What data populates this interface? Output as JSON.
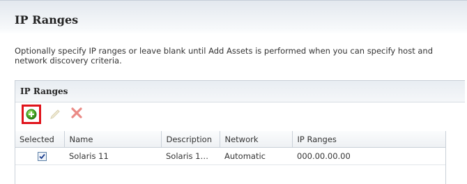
{
  "page": {
    "title": "IP Ranges",
    "description": "Optionally specify IP ranges or leave blank until Add Assets is performed when you can specify host and network discovery criteria."
  },
  "panel": {
    "title": "IP Ranges",
    "toolbar": {
      "add_icon": "add-icon",
      "edit_icon": "pencil-icon",
      "delete_icon": "delete-x-icon",
      "highlight_color": "#e0131b"
    },
    "table": {
      "columns": [
        "Selected",
        "Name",
        "Description",
        "Network",
        "IP Ranges"
      ],
      "rows": [
        {
          "selected": true,
          "name": "Solaris 11",
          "description": "Solaris 1…",
          "network": "Automatic",
          "ip_ranges": "000.00.00.00"
        }
      ]
    }
  }
}
